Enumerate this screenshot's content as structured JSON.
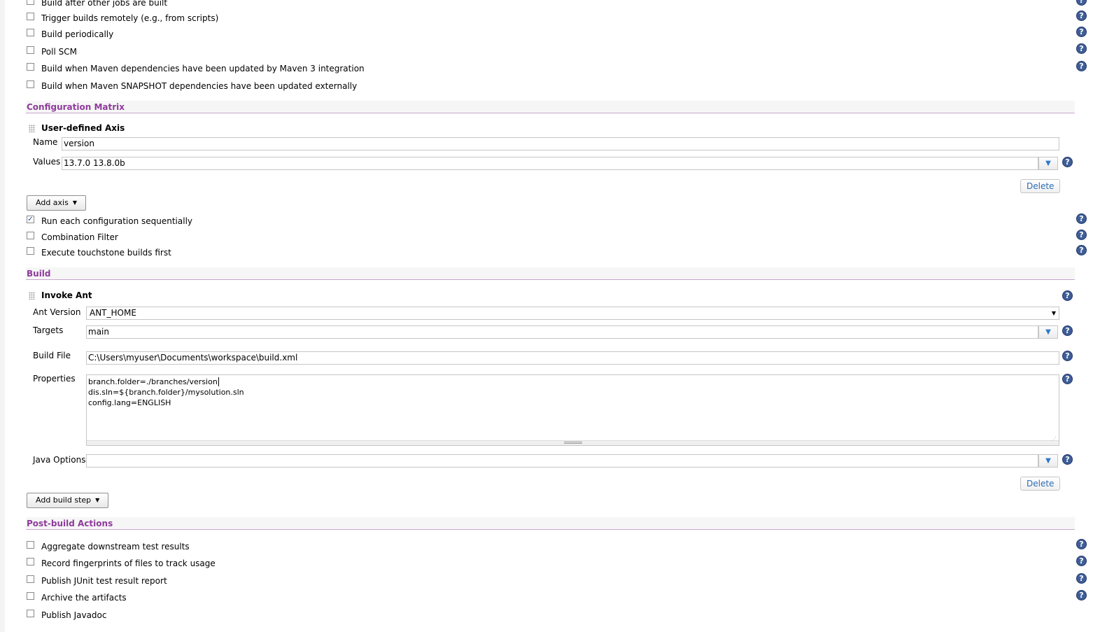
{
  "triggers": {
    "items": [
      {
        "label": "Build after other jobs are built",
        "checked": false
      },
      {
        "label": "Trigger builds remotely (e.g., from scripts)",
        "checked": false
      },
      {
        "label": "Build periodically",
        "checked": false
      },
      {
        "label": "Poll SCM",
        "checked": false
      },
      {
        "label": "Build when Maven dependencies have been updated by Maven 3 integration",
        "checked": false
      },
      {
        "label": "Build when Maven SNAPSHOT dependencies have been updated externally",
        "checked": false
      }
    ]
  },
  "config_matrix": {
    "section_title": "Configuration Matrix",
    "axis": {
      "title": "User-defined Axis",
      "name_label": "Name",
      "name_value": "version",
      "values_label": "Values",
      "values_value": "13.7.0 13.8.0b",
      "delete_label": "Delete"
    },
    "add_axis_label": "Add axis",
    "options": [
      {
        "label": "Run each configuration sequentially",
        "checked": true
      },
      {
        "label": "Combination Filter",
        "checked": false
      },
      {
        "label": "Execute touchstone builds first",
        "checked": false
      }
    ]
  },
  "build": {
    "section_title": "Build",
    "step": {
      "title": "Invoke Ant",
      "ant_version_label": "Ant Version",
      "ant_version_value": "ANT_HOME",
      "targets_label": "Targets",
      "targets_value": "main",
      "build_file_label": "Build File",
      "build_file_value": "C:\\Users\\myuser\\Documents\\workspace\\build.xml",
      "properties_label": "Properties",
      "properties_lines": [
        "branch.folder=./branches/version",
        "dis.sln=${branch.folder}/mysolution.sln",
        "config.lang=ENGLISH"
      ],
      "java_options_label": "Java Options",
      "java_options_value": "",
      "delete_label": "Delete"
    },
    "add_build_step_label": "Add build step"
  },
  "post_build": {
    "section_title": "Post-build Actions",
    "items": [
      {
        "label": "Aggregate downstream test results",
        "checked": false
      },
      {
        "label": "Record fingerprints of files to track usage",
        "checked": false
      },
      {
        "label": "Publish JUnit test result report",
        "checked": false
      },
      {
        "label": "Archive the artifacts",
        "checked": false
      },
      {
        "label": "Publish Javadoc",
        "checked": false
      }
    ]
  },
  "icons": {
    "help": "help-icon",
    "dropdown": "expand-dropdown-icon",
    "drag": "drag-handle-icon",
    "check": "✓"
  },
  "colors": {
    "section_title": "#8e3b9b",
    "help_icon": "#3f5e98",
    "link_blue": "#2b6db5"
  }
}
